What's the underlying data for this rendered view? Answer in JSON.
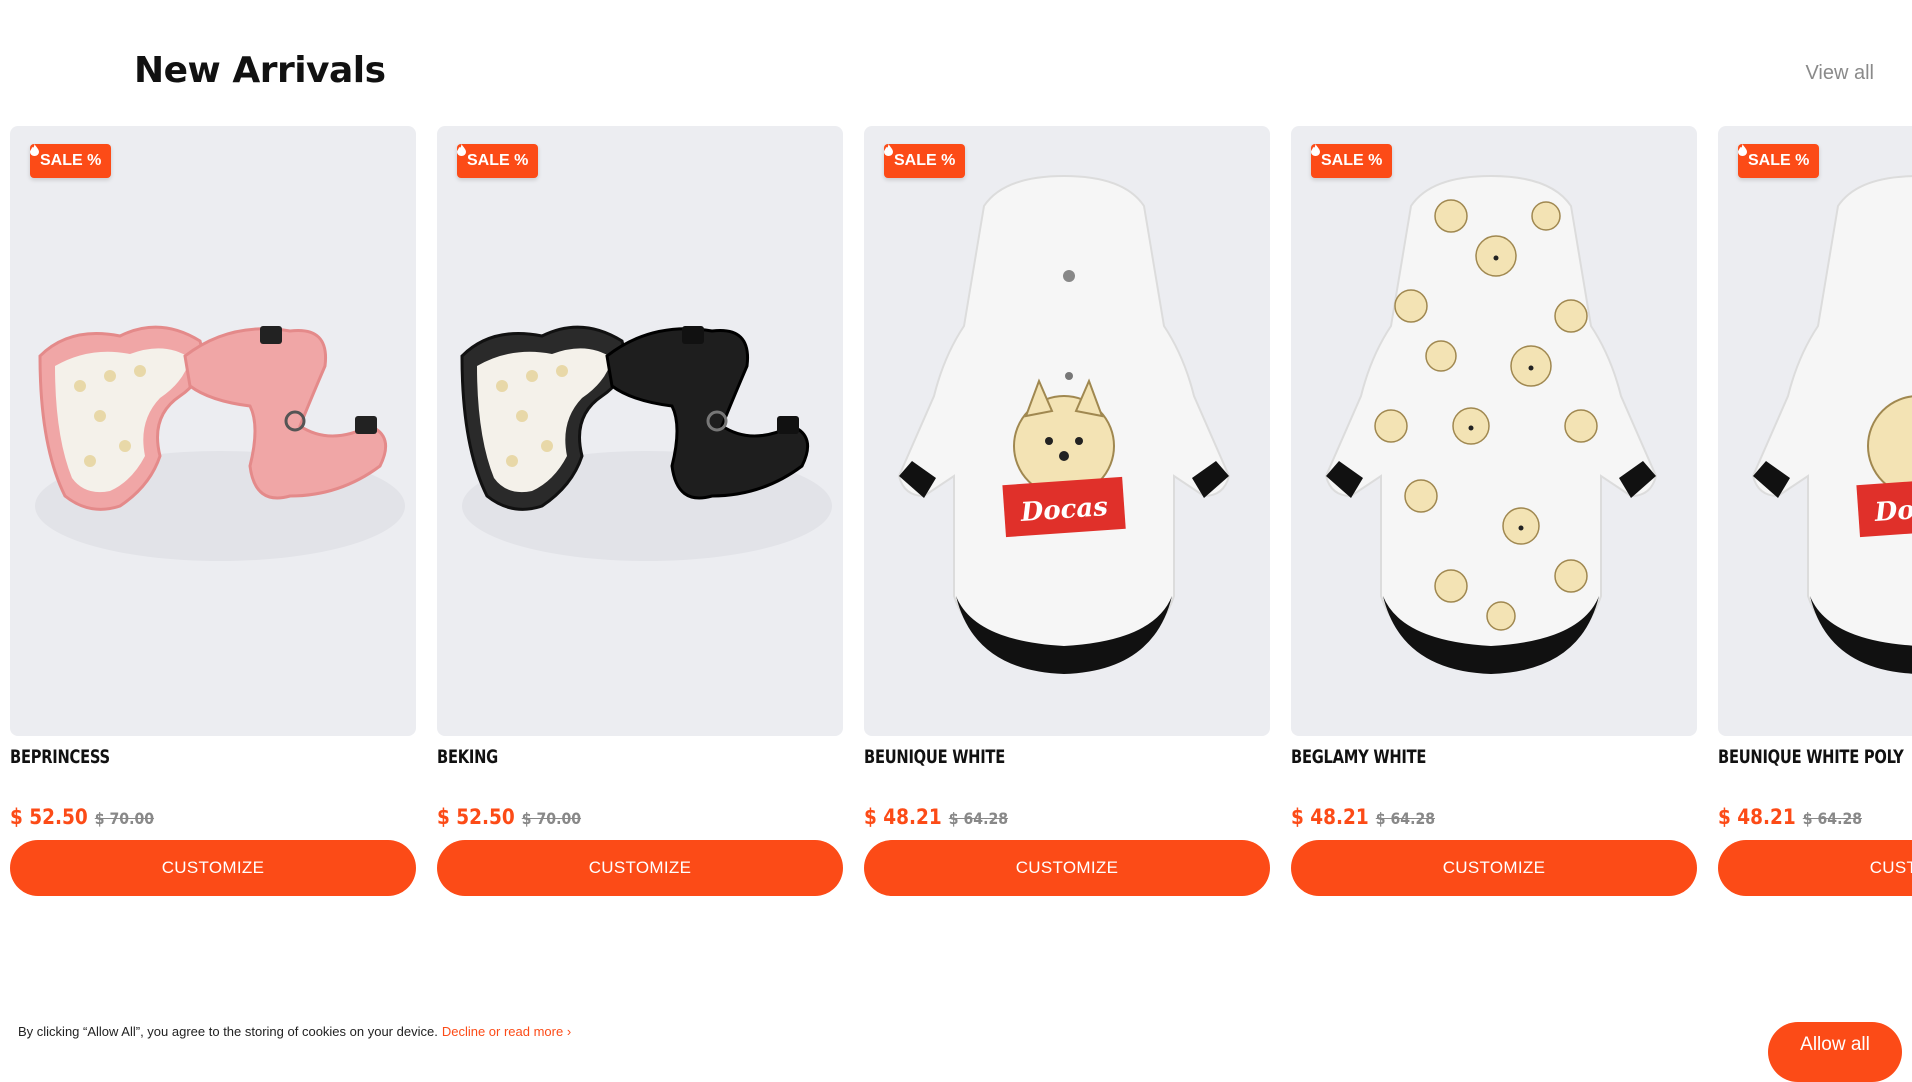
{
  "section": {
    "title": "New Arrivals",
    "view_all": "View all"
  },
  "products": [
    {
      "badge": "SALE %",
      "name": "BEPRINCESS",
      "price": "$ 52.50",
      "old_price": "$ 70.00",
      "button": "CUSTOMIZE",
      "image": "pink-harness-pair"
    },
    {
      "badge": "SALE %",
      "name": "BEKING",
      "price": "$ 52.50",
      "old_price": "$ 70.00",
      "button": "CUSTOMIZE",
      "image": "black-harness-pair"
    },
    {
      "badge": "SALE %",
      "name": "BEUNIQUE WHITE",
      "price": "$ 48.21",
      "old_price": "$ 64.28",
      "button": "CUSTOMIZE",
      "image": "white-hoodie-docas"
    },
    {
      "badge": "SALE %",
      "name": "BEGLAMY WHITE",
      "price": "$ 48.21",
      "old_price": "$ 64.28",
      "button": "CUSTOMIZE",
      "image": "white-hoodie-pattern"
    },
    {
      "badge": "SALE %",
      "name": "BEUNIQUE WHITE POLY",
      "price": "$ 48.21",
      "old_price": "$ 64.28",
      "button": "CUSTOMIZE",
      "image": "white-hoodie-docas"
    }
  ],
  "cookie_banner": {
    "text": "By clicking “Allow All”, you agree to the storing of cookies on your device.",
    "link": "Decline or read more ›",
    "button": "Allow all"
  },
  "colors": {
    "accent": "#fc4b17",
    "card_bg": "#ecedf1",
    "text": "#111111",
    "muted": "#8a8a8a"
  }
}
